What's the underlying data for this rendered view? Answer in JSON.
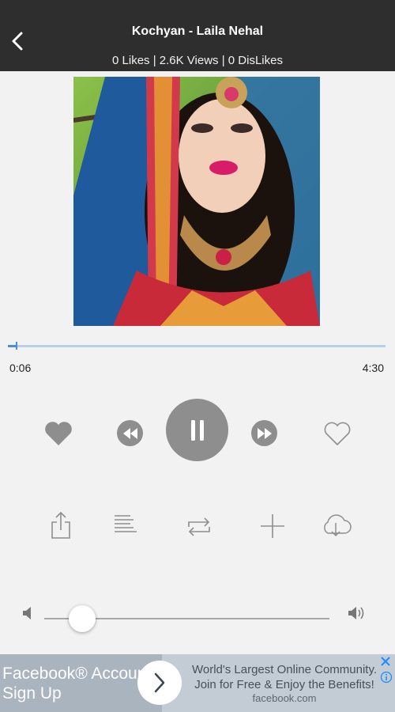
{
  "header": {
    "title": "Kochyan - Laila Nehal",
    "stats": "0 Likes | 2.6K Views | 0 DisLikes",
    "background": "#2e2e2e"
  },
  "artwork": {
    "icon": "album-artwork-image"
  },
  "player": {
    "current_time": "0:06",
    "total_time": "4:30",
    "progress": 0.022,
    "accent": "#4a90d9"
  },
  "controls": {
    "icons": [
      "heart-filled-icon",
      "rewind-icon",
      "pause-icon",
      "fast-forward-icon",
      "heart-outline-icon"
    ]
  },
  "actions": {
    "icons": [
      "share-icon",
      "lyrics-icon",
      "repeat-icon",
      "add-icon",
      "cloud-download-icon"
    ]
  },
  "volume": {
    "level": 0.13,
    "icons": [
      "volume-low-icon",
      "volume-high-icon"
    ]
  },
  "ad": {
    "headline": "Facebook® Account Sign Up",
    "body": "World's Largest Online Community. Join for Free & Enjoy the Benefits!",
    "domain": "facebook.com",
    "accent": "#1a8cff"
  }
}
